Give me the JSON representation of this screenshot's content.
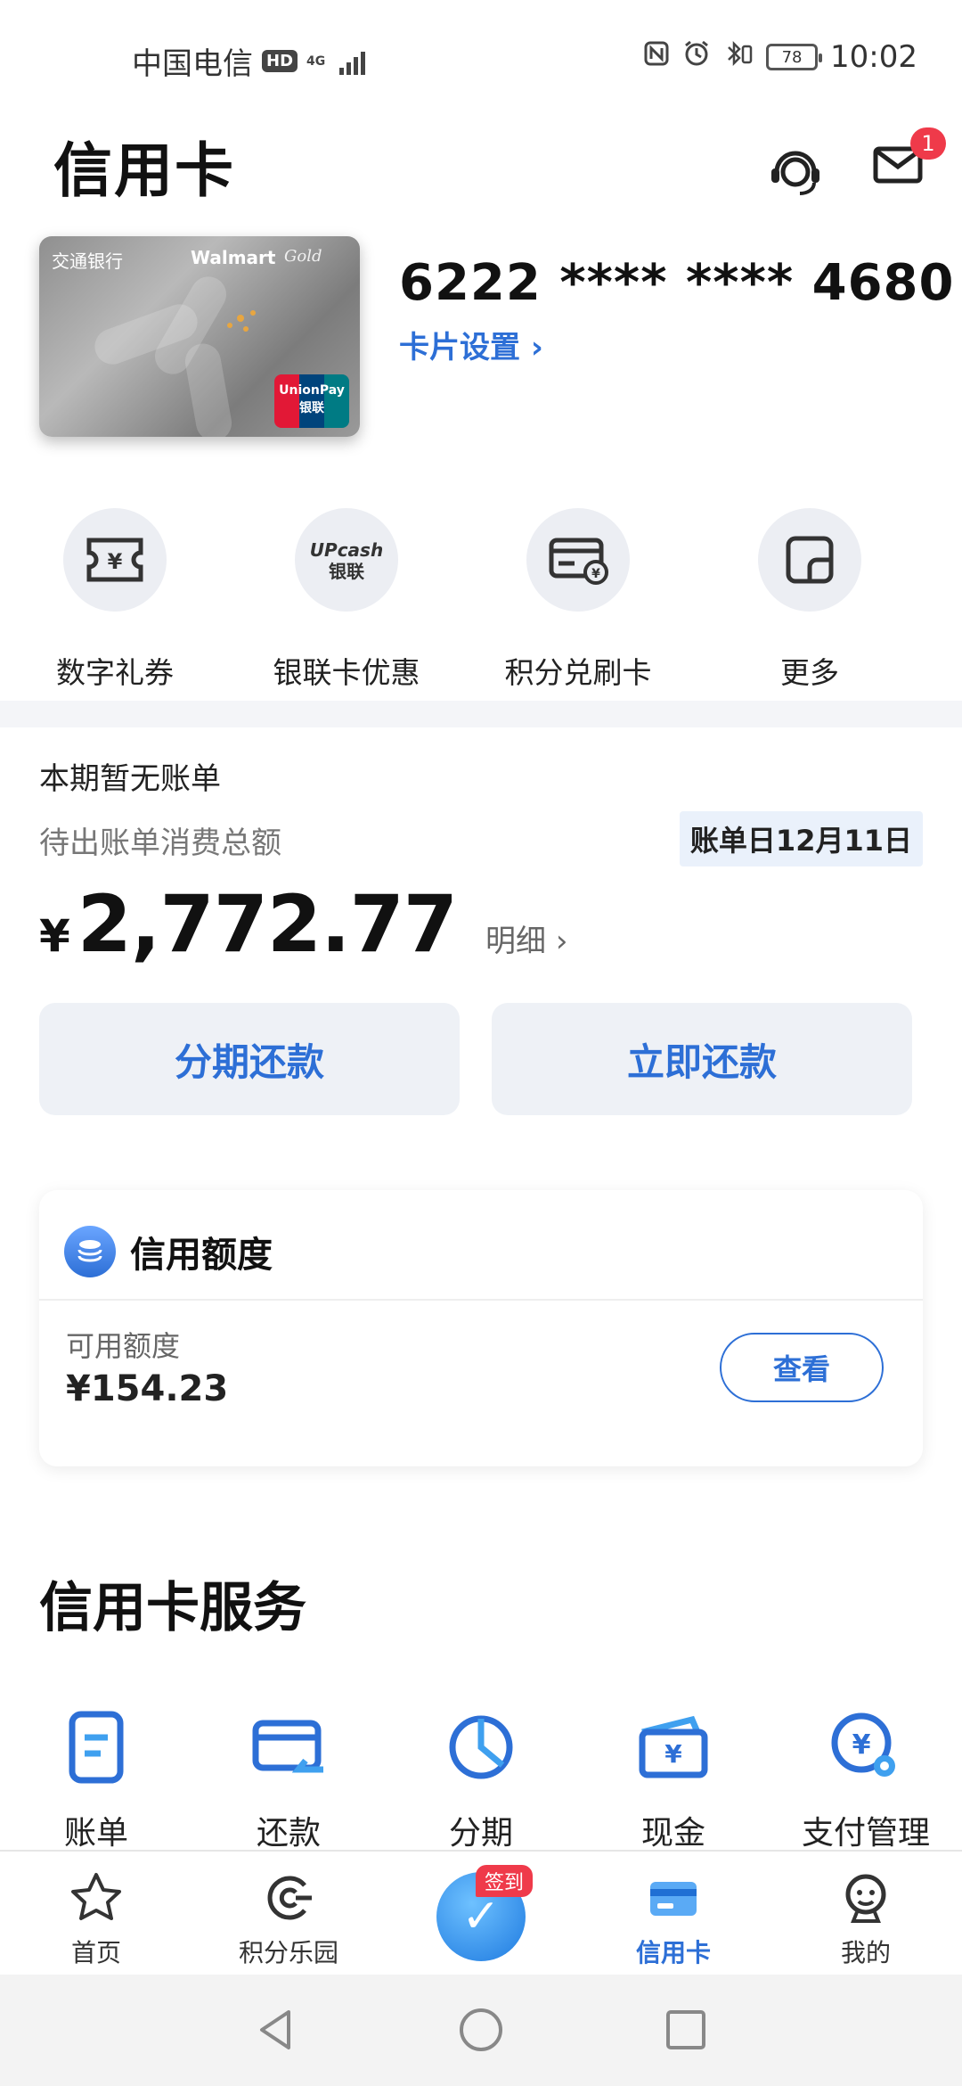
{
  "status_bar": {
    "carrier": "中国电信",
    "hd": "HD",
    "network": "4G",
    "battery": "78",
    "time": "10:02"
  },
  "header": {
    "title": "信用卡",
    "mail_badge": "1"
  },
  "card": {
    "number": "6222 **** **** 4680",
    "settings_label": "卡片设置",
    "image_text": {
      "bank": "交通银行",
      "brand": "Walmart",
      "tier": "Gold",
      "network": "UnionPay 银联"
    }
  },
  "quick_actions": [
    {
      "label": "数字礼券",
      "icon": "voucher-icon"
    },
    {
      "label": "银联卡优惠",
      "icon": "upcash-icon"
    },
    {
      "label": "积分兑刷卡",
      "icon": "points-card-icon"
    },
    {
      "label": "更多",
      "icon": "more-icon"
    }
  ],
  "bill": {
    "status": "本期暂无账单",
    "pending_label": "待出账单消费总额",
    "bill_date": "账单日12月11日",
    "currency": "¥",
    "amount": "2,772.77",
    "detail_label": "明细",
    "installment_button": "分期还款",
    "repay_button": "立即还款"
  },
  "credit_limit": {
    "title": "信用额度",
    "available_label": "可用额度",
    "available_value": "¥154.23",
    "view_button": "查看"
  },
  "services": {
    "title": "信用卡服务",
    "items": [
      {
        "label": "账单",
        "icon": "bill-icon"
      },
      {
        "label": "还款",
        "icon": "repay-icon"
      },
      {
        "label": "分期",
        "icon": "installment-icon"
      },
      {
        "label": "现金",
        "icon": "cash-icon"
      },
      {
        "label": "支付管理",
        "icon": "payment-settings-icon"
      }
    ]
  },
  "bottom_nav": {
    "items": [
      {
        "label": "首页",
        "icon": "star-icon"
      },
      {
        "label": "积分乐园",
        "icon": "points-icon"
      },
      {
        "label": "信用卡",
        "icon": "credit-card-icon",
        "active": true
      },
      {
        "label": "我的",
        "icon": "profile-icon"
      }
    ],
    "center_badge": "签到"
  },
  "colors": {
    "accent": "#2d6fd6",
    "badge": "#ef3a4a",
    "button_bg": "#eef1f6"
  }
}
